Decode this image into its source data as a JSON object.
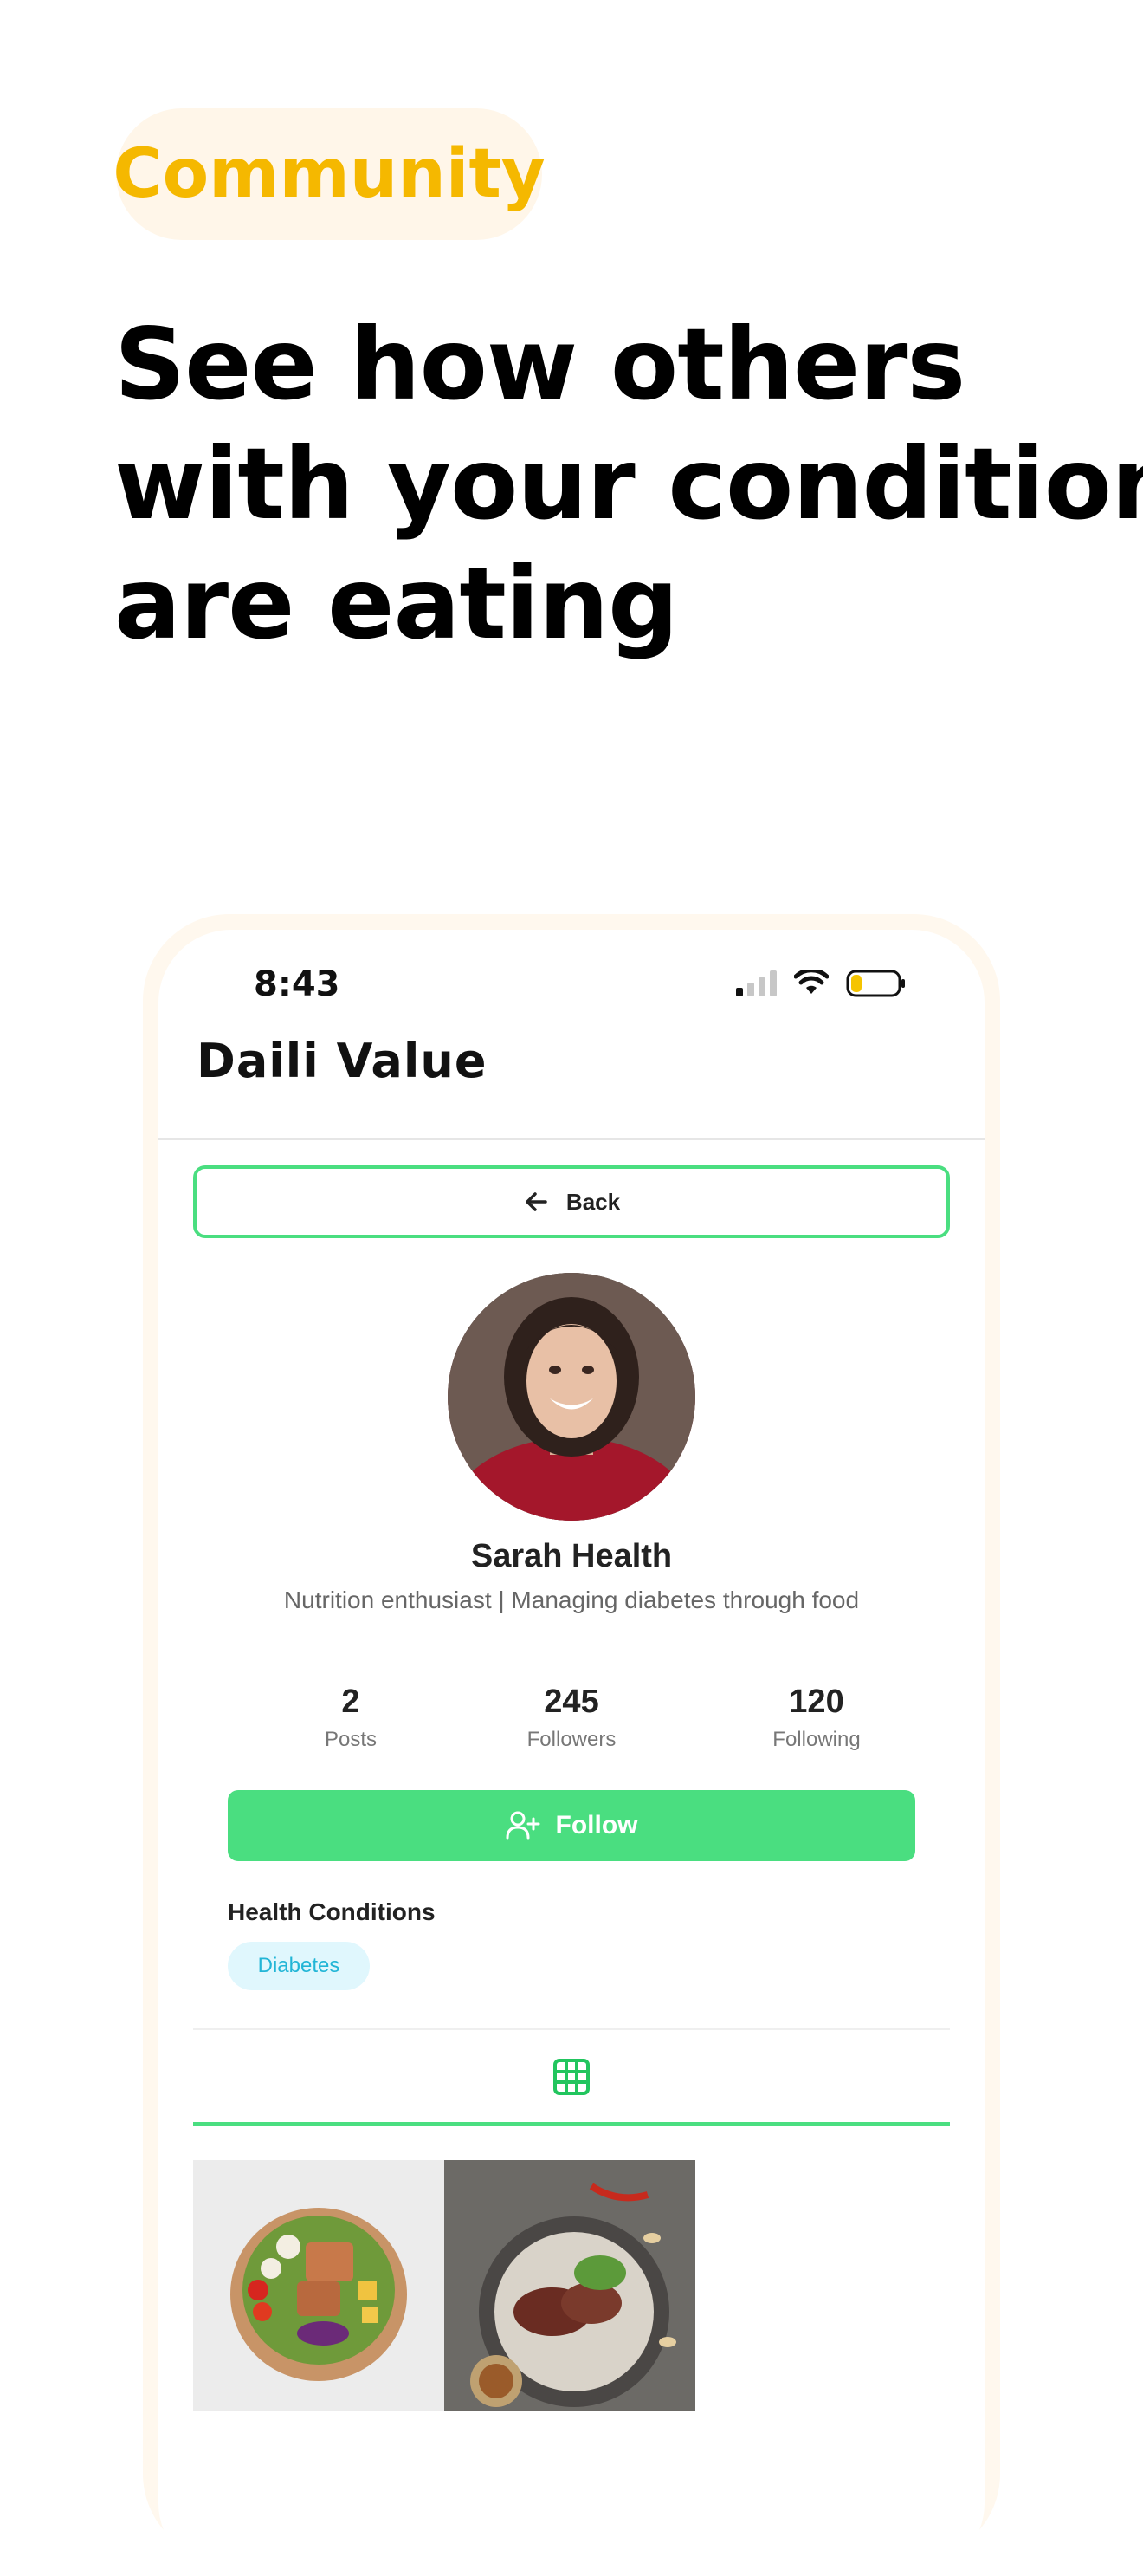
{
  "promo": {
    "badge": "Community",
    "headline_lines": [
      "See how others",
      "with your condition",
      "are eating"
    ]
  },
  "status_bar": {
    "time": "8:43"
  },
  "app": {
    "logo": "Daili Value"
  },
  "profile": {
    "back_label": "Back",
    "name": "Sarah Health",
    "bio": "Nutrition enthusiast | Managing diabetes through food",
    "stats": [
      {
        "value": "2",
        "label": "Posts"
      },
      {
        "value": "245",
        "label": "Followers"
      },
      {
        "value": "120",
        "label": "Following"
      }
    ],
    "follow_label": "Follow",
    "health_conditions_title": "Health Conditions",
    "conditions": [
      "Diabetes"
    ]
  },
  "colors": {
    "accent": "#4ade80",
    "badge_text": "#f5b800",
    "tag_text": "#22b5d6"
  },
  "icons": [
    "arrow-left-icon",
    "user-plus-icon",
    "grid-icon",
    "signal-icon",
    "wifi-icon",
    "battery-icon"
  ]
}
